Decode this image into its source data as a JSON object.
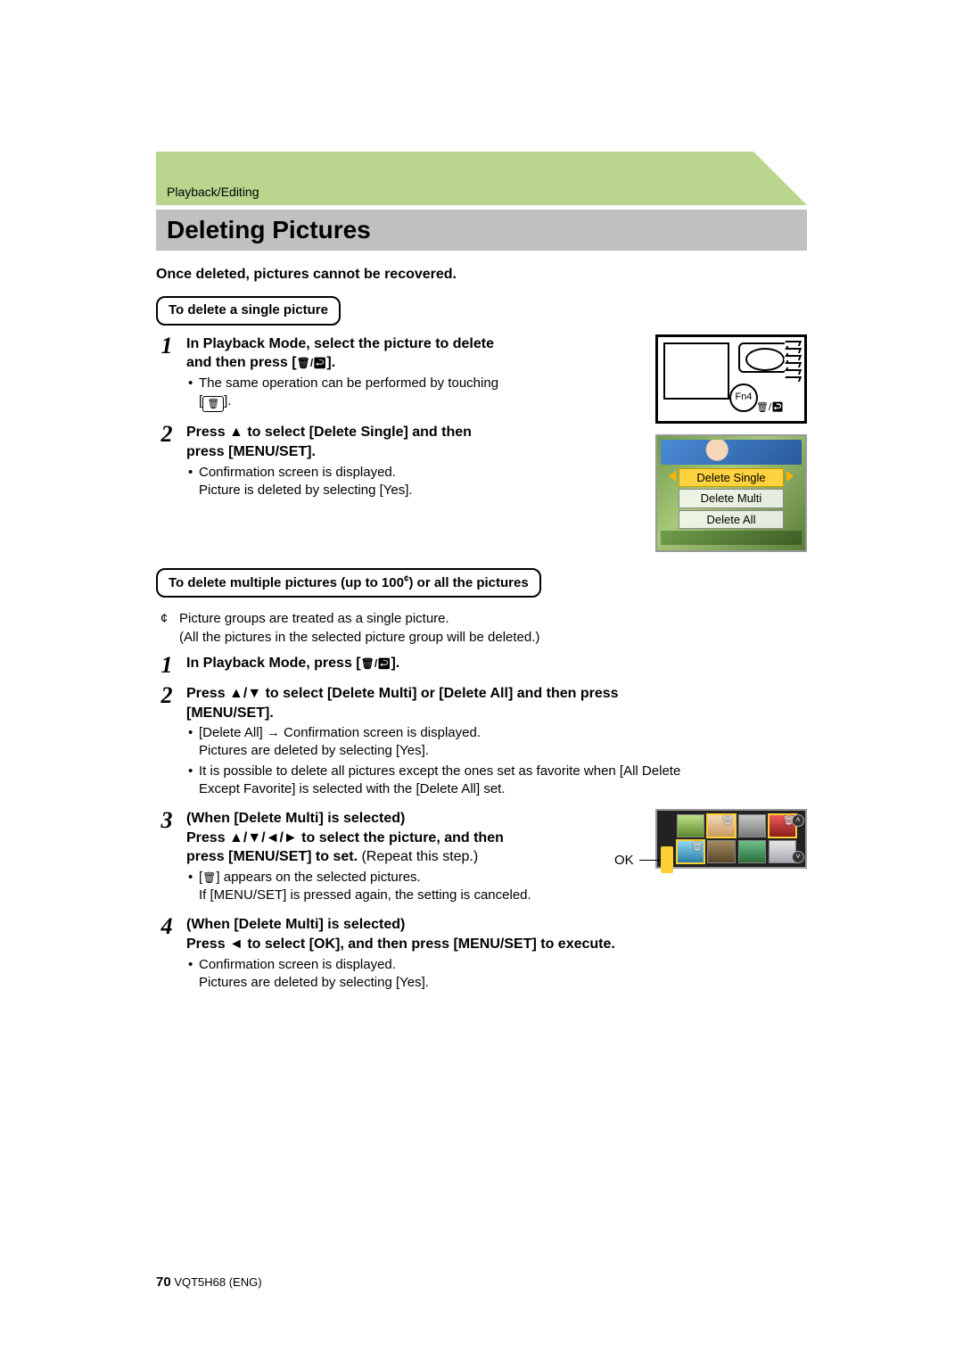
{
  "breadcrumb": "Playback/Editing",
  "title": "Deleting Pictures",
  "warning": "Once deleted, pictures cannot be recovered.",
  "section_single_title": "To delete a single picture",
  "single_steps": {
    "s1": {
      "num": "1",
      "head_a": "In Playback Mode, select the picture to delete",
      "head_b": "and then press [",
      "head_c": "].",
      "bullet_a": "The same operation can be performed by touching",
      "bullet_b": "[",
      "bullet_c": "]."
    },
    "s2": {
      "num": "2",
      "head_a": "Press ▲ to select [Delete Single] and then",
      "head_b": "press [MENU/SET].",
      "bullet_a": "Confirmation screen is displayed.",
      "bullet_b": "Picture is deleted by selecting [Yes]."
    }
  },
  "camera_fig": {
    "fn_label": "Fn4"
  },
  "menu_fig": {
    "opt_single": "Delete Single",
    "opt_multi": "Delete Multi",
    "opt_all": "Delete All"
  },
  "section_multi_title_a": "To delete multiple pictures (up to 100",
  "section_multi_title_b": ") or all the pictures",
  "asterisk_mark": "¢",
  "asterisk_note_a": "Picture groups are treated as a single picture.",
  "asterisk_note_b": "(All the pictures in the selected picture group will be deleted.)",
  "multi_steps": {
    "s1": {
      "num": "1",
      "head_a": "In Playback Mode, press [",
      "head_b": "]."
    },
    "s2": {
      "num": "2",
      "head_a": "Press ▲/▼ to select [Delete Multi] or [Delete All] and then press",
      "head_b": "[MENU/SET].",
      "bullet_a_1": "[Delete All] → Confirmation screen is displayed.",
      "bullet_a_2": "Pictures are deleted by selecting [Yes].",
      "bullet_b_1": "It is possible to delete all pictures except the ones set as favorite when [All Delete",
      "bullet_b_2": "Except Favorite] is selected with the [Delete All] set."
    },
    "s3": {
      "num": "3",
      "head_a": "(When [Delete Multi] is selected)",
      "head_b": "Press ▲/▼/◄/► to select the picture, and then",
      "head_c_bold": "press [MENU/SET] to set.",
      "head_c_plain": " (Repeat this step.)",
      "bullet_a_1": "[",
      "bullet_a_2": "] appears on the selected pictures.",
      "bullet_a_3": "If [MENU/SET] is pressed again, the setting is canceled."
    },
    "s4": {
      "num": "4",
      "head_a": "(When [Delete Multi] is selected)",
      "head_b": "Press ◄ to select [OK], and then press [MENU/SET] to execute.",
      "bullet_a": "Confirmation screen is displayed.",
      "bullet_b": "Pictures are deleted by selecting [Yes]."
    }
  },
  "grid_fig": {
    "ok_label": "OK"
  },
  "footer": {
    "page": "70",
    "doc": "VQT5H68 (ENG)"
  }
}
